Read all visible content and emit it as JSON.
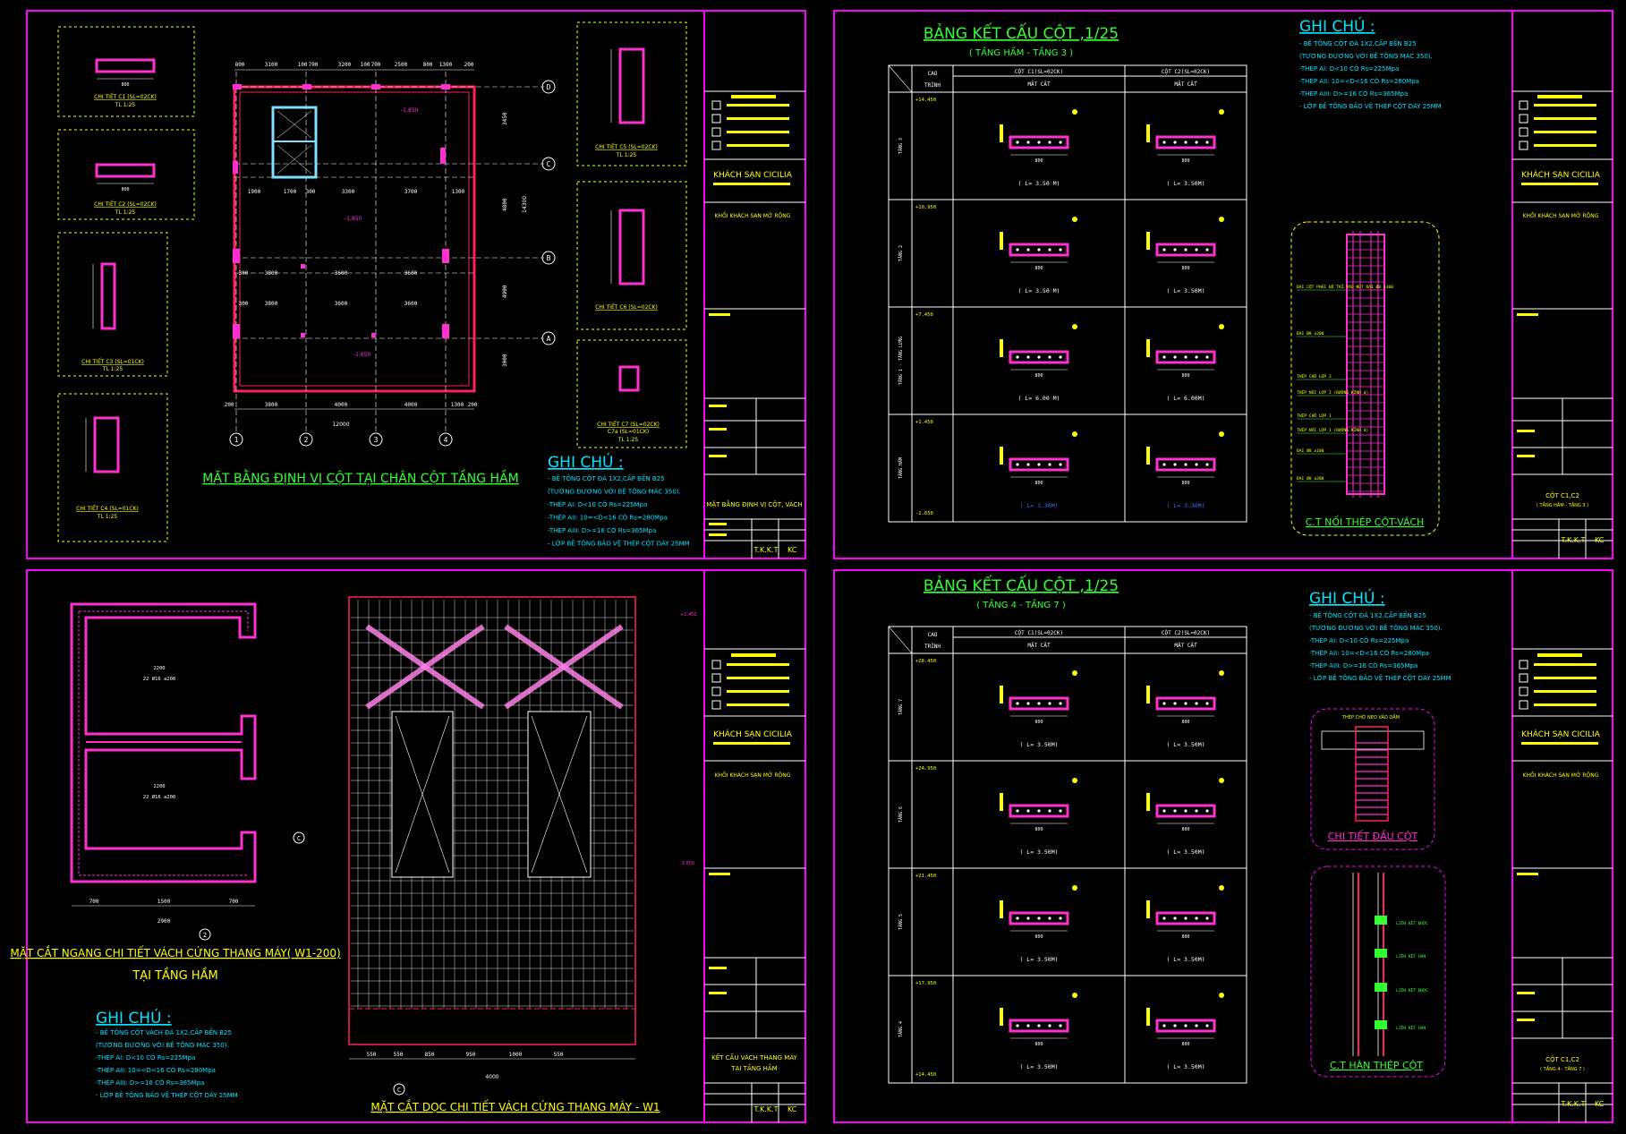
{
  "colors": {
    "frame": "#ff00ff",
    "line": "#ffffff",
    "rebar": "#ff2fd0",
    "title": "#33ff33",
    "note": "#00e5ff",
    "label": "#ffff00",
    "wall": "#ff2060",
    "grid": "#d8d8d8",
    "blue": "#3b6bff"
  },
  "sheet1": {
    "details": [
      {
        "label": "CHI TIẾT C1 (SL=02CK)",
        "scale": "TL 1:25"
      },
      {
        "label": "CHI TIẾT C2 (SL=02CK)",
        "scale": "TL 1:25"
      },
      {
        "label": "CHI TIẾT C3 (SL=01CK)",
        "scale": "TL 1:25"
      },
      {
        "label": "CHI TIẾT C4 (SL=01CK)",
        "scale": "TL 1:25"
      }
    ],
    "details_right": [
      {
        "label": "CHI TIẾT C5 (SL=02CK)",
        "scale": "TL 1:25"
      },
      {
        "label": "CHI TIẾT C6 (SL=02CK)",
        "scale": ""
      },
      {
        "label": "CHI TIẾT C7 (SL=02CK)",
        "label2": "C7a (SL=01CK)",
        "scale": "TL 1:25"
      }
    ],
    "top_dims": [
      "800",
      "3100",
      "100",
      "700",
      "3200",
      "100",
      "700",
      "2500",
      "800",
      "1300",
      "200"
    ],
    "bottom_dims": [
      "200",
      "3800",
      "4000",
      "4000",
      "1300",
      "200"
    ],
    "total_dim": "12000",
    "right_dims": [
      "3450",
      "4800",
      "4900",
      "3000"
    ],
    "right_total": "14300",
    "mid_dims": [
      "1900",
      "1700",
      "300",
      "3300",
      "3700",
      "1300"
    ],
    "row_dims_1": [
      "300",
      "3800",
      "3600",
      "3600"
    ],
    "row_dims_2": [
      "300",
      "3800",
      "3600",
      "3600"
    ],
    "levels": [
      "-1.850",
      "-1.850",
      "-1.650"
    ],
    "grid_cols": [
      "1",
      "2",
      "3",
      "4"
    ],
    "grid_rows": [
      "D",
      "C",
      "B",
      "A"
    ],
    "plan_title": "MẶT BẰNG ĐỊNH VỊ CỘT TẠI CHÂN CỘT TẦNG HẦM",
    "notes_title": "GHI CHÚ :",
    "notes": [
      "- BÊ TÔNG CỘT ĐÁ 1X2,CẤP BỀN B25",
      "  (TƯƠNG ĐƯƠNG VỚI BÊ TÔNG MÁC 350).",
      "-THÉP AI: D<10 CÓ Rs=225Mpa",
      "-THÉP AII: 10=<D<16 CÓ Rs=280Mpa",
      "-THÉP AIII: D>=16 CÓ Rs=365Mpa",
      "- LỚP BÊ TÔNG BẢO VỆ THÉP CỘT DÀY 25MM"
    ],
    "tb_project": "KHÁCH SẠN CICILIA",
    "tb_sub": "KHỐI KHÁCH SẠN MỞ RỘNG",
    "tb_drawing": "MẶT BẰNG ĐỊNH VỊ CỘT, VÁCH",
    "tb_code": "T.K.K.T",
    "tb_no": "KC"
  },
  "sheet2": {
    "title": "BẢNG KẾT CẤU CỘT ,1/25",
    "subtitle": "( TẦNG HẦM - TẦNG 3 )",
    "head_cao": "CAO",
    "head_trinh": "TRÌNH",
    "head_c1": "CỘT C1(SL=02CK)",
    "head_c2": "CỘT C2(SL=02CK)",
    "head_matcat": "MẶT CẮT",
    "floors": [
      "TẦNG 3",
      "TẦNG 2",
      "TẦNG 1 - TẦNG LỬNG",
      "TẦNG HẦM"
    ],
    "elevs": [
      "+14.450",
      "+10.950",
      "+7.450",
      "+1.450",
      "-1.650"
    ],
    "lens": [
      "( L= 3.50 M)",
      "( L= 3.50M)",
      "( L= 3.50 M)",
      "( L= 3.50M)",
      "( L= 6.00 M)",
      "( L= 6.00M)",
      "( L= 3.30M)",
      "( L= 3.30M)"
    ],
    "section_dim": "800",
    "notes_title": "GHI CHÚ :",
    "notes": [
      "- BÊ TÔNG CỘT ĐÁ 1X2,CẤP BỀN B25",
      "  (TƯƠNG ĐƯƠNG VỚI BÊ TÔNG MÁC 350).",
      "-THÉP AI: D<10 CÓ Rs=225Mpa",
      "-THÉP AII: 10=<D<16 CÓ Rs=280Mpa",
      "-THÉP AIII: D>=16 CÓ Rs=365Mpa",
      "- LỚP BÊ TÔNG BẢO VỆ THÉP CỘT DÀY 25MM"
    ],
    "detail_title": "C.T NỐI THÉP CỘT-VÁCH",
    "detail_labels": [
      "ĐAI CỘT PHẢI BỐ TRÍ VÀO NÚT ĐAI Ø8 a100",
      "ĐAI Ø8 a200",
      "THÉP CHỜ LỚP 2",
      "THÉP NỐI LỚP 2 (ĐƯỜNG KÍNH d)",
      "THÉP CHỜ LỚP 1",
      "THÉP NỐI LỚP 1 (ĐƯỜNG KÍNH d)",
      "ĐAI Ø8 a100",
      "ĐAI Ø8 a200"
    ],
    "tb_project": "KHÁCH SẠN CICILIA",
    "tb_sub": "KHỐI KHÁCH SẠN MỞ RỘNG",
    "tb_drawing": "CỘT C1,C2",
    "tb_drawing2": "( TẦNG HẦM - TẦNG 3 )",
    "tb_code": "T.K.K.T",
    "tb_no": "KC"
  },
  "sheet3": {
    "plan_title": "MẶT CẮT NGANG CHI TIẾT VÁCH CỨNG THANG MÁY( W1-200)",
    "plan_title2": "TẠI TẦNG HẦM",
    "dims_bottom": [
      "700",
      "1500",
      "700"
    ],
    "total_bottom": "2900",
    "inner_dims": [
      "2200",
      "22 Ø16 a200",
      "2200",
      "22 Ø16 a200"
    ],
    "grid_c": "C",
    "grid_2": "2",
    "elev_top": "+1.450",
    "elev_bot": "-3.850",
    "section_title": "MẶT CẮT DỌC CHI TIẾT VÁCH CỨNG THANG MÁY - W1",
    "section_dims": [
      "550",
      "550",
      "850",
      "950",
      "1000",
      "550"
    ],
    "section_total": "4000",
    "notes_title": "GHI CHÚ :",
    "notes": [
      "- BÊ TÔNG CỘT VÁCH ĐÁ 1X2,CẤP BỀN B25",
      "  (TƯƠNG ĐƯƠNG VỚI BÊ TÔNG MÁC 350).",
      "-THÉP AI: D<10 CÓ Rs=225Mpa",
      "-THÉP AII: 10=<D<16 CÓ Rs=280Mpa",
      "-THÉP AIII: D>=16 CÓ Rs=365Mpa",
      "- LỚP BÊ TÔNG BẢO VỆ THÉP CỘT DÀY 25MM"
    ],
    "tb_project": "KHÁCH SẠN CICILIA",
    "tb_sub": "KHỐI KHÁCH SẠN MỞ RỘNG",
    "tb_drawing": "KẾT CẤU VÁCH THANG MÁY",
    "tb_drawing2": "TẠI TẦNG HẦM",
    "tb_code": "T.K.K.T",
    "tb_no": "KC"
  },
  "sheet4": {
    "title": "BẢNG KẾT CẤU CỘT ,1/25",
    "subtitle": "( TẦNG 4 - TẦNG 7 )",
    "head_cao": "CAO",
    "head_trinh": "TRÌNH",
    "head_c1": "CỘT C1(SL=02CK)",
    "head_c2": "CỘT C2(SL=02CK)",
    "head_matcat": "MẶT CẮT",
    "floors": [
      "TẦNG 7",
      "TẦNG 6",
      "TẦNG 5",
      "TẦNG 4"
    ],
    "elevs": [
      "+28.450",
      "+24.950",
      "+21.450",
      "+17.950",
      "+14.450"
    ],
    "lens": [
      "( L= 3.50M)",
      "( L= 3.50M)",
      "( L= 3.50M)",
      "( L= 3.50M)",
      "( L= 3.50M)",
      "( L= 3.50M)",
      "( L= 3.50M)",
      "( L= 3.50M)"
    ],
    "section_dim": "800",
    "notes_title": "GHI CHÚ :",
    "notes": [
      "- BÊ TÔNG CỘT ĐÁ 1X2,CẤP BỀN B25",
      "  (TƯƠNG ĐƯƠNG VỚI BÊ TÔNG MÁC 350).",
      "-THÉP AI: D<10 CÓ Rs=225Mpa",
      "-THÉP AII: 10=<D<16 CÓ Rs=280Mpa",
      "-THÉP AIII: D>=16 CÓ Rs=365Mpa",
      "- LỚP BÊ TÔNG BẢO VỆ THÉP CỘT DÀY 25MM"
    ],
    "detail1_title": "CHI TIẾT ĐẦU CỘT",
    "detail1_label": "THÉP CHỜ NEO VÀO DẦM",
    "detail2_title": "C.T HÀN THÉP CỘT",
    "detail2_labels": [
      "LIÊN KẾT ĐƯỢC",
      "LIÊN KẾT HÀN",
      "LIÊN KẾT ĐƯỢC",
      "LIÊN KẾT HÀN"
    ],
    "tb_project": "KHÁCH SẠN CICILIA",
    "tb_sub": "KHỐI KHÁCH SẠN MỞ RỘNG",
    "tb_drawing": "CỘT C1,C2",
    "tb_drawing2": "( TẦNG 4 - TẦNG 7 )",
    "tb_code": "T.K.K.T",
    "tb_no": "KC"
  }
}
